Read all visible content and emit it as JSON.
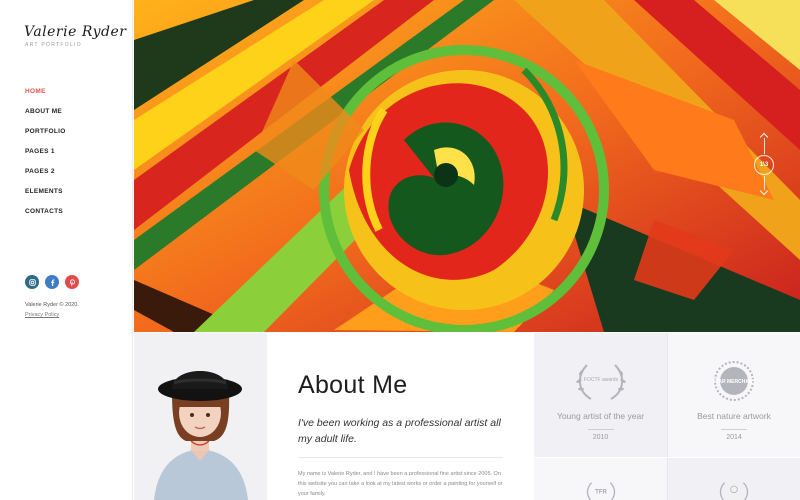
{
  "brand": {
    "name": "Valerie Ryder",
    "subtitle": "ART PORTFOLIO"
  },
  "nav": [
    {
      "label": "HOME",
      "active": true
    },
    {
      "label": "ABOUT ME"
    },
    {
      "label": "PORTFOLIO"
    },
    {
      "label": "PAGES 1"
    },
    {
      "label": "PAGES 2"
    },
    {
      "label": "ELEMENTS"
    },
    {
      "label": "CONTACTS"
    }
  ],
  "social": [
    {
      "icon": "instagram-icon",
      "color": "#2f6b86"
    },
    {
      "icon": "facebook-icon",
      "color": "#3e7cc4"
    },
    {
      "icon": "pinterest-icon",
      "color": "#e34a4e"
    }
  ],
  "footer": {
    "copyright": "Valerie Ryder © 2020.",
    "privacy": "Privacy Policy"
  },
  "slider": {
    "counter": "1\\3"
  },
  "about": {
    "title": "About Me",
    "lead": "I've been working as a professional artist all my adult life.",
    "body": "My name is Valerie Ryder, and I have been a professional fine artist since 2005. On this website you can take a look at my latest works or order a painting for yourself or your family."
  },
  "awards": [
    {
      "title": "Young artist of the year",
      "year": "2010",
      "badge": "FOCTF awards"
    },
    {
      "title": "Best nature artwork",
      "year": "2014",
      "badge": "STAR MERCHANT"
    },
    {
      "title": "",
      "year": "",
      "badge": "TFR"
    },
    {
      "title": "",
      "year": "",
      "badge": ""
    }
  ],
  "colors": {
    "accent": "#e3514d",
    "award_bg": "#f1f1f5"
  }
}
